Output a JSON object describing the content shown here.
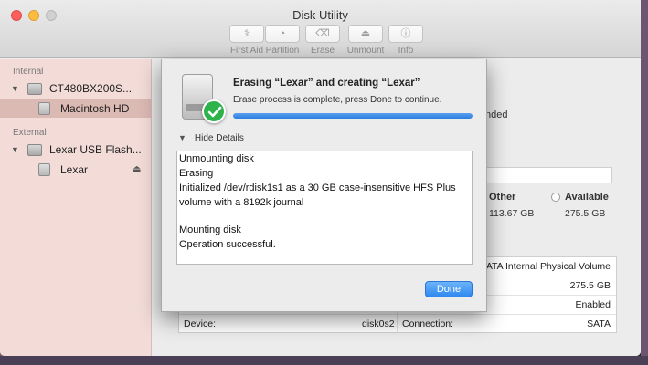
{
  "window": {
    "title": "Disk Utility"
  },
  "toolbar": {
    "buttons": [
      {
        "label": "First Aid",
        "icon": "stethoscope-icon",
        "glyph": "⚕"
      },
      {
        "label": "Partition",
        "icon": "partition-icon",
        "glyph": "◔"
      },
      {
        "label": "Erase",
        "icon": "erase-icon",
        "glyph": "⌫"
      },
      {
        "label": "Unmount",
        "icon": "unmount-icon",
        "glyph": "⏏"
      },
      {
        "label": "Info",
        "icon": "info-icon",
        "glyph": "ⓘ"
      }
    ]
  },
  "sidebar": {
    "internal_header": "Internal",
    "external_header": "External",
    "items": [
      {
        "label": "CT480BX200S...",
        "type": "disk"
      },
      {
        "label": "Macintosh HD",
        "type": "volume",
        "selected": true
      },
      {
        "label": "Lexar USB Flash...",
        "type": "disk"
      },
      {
        "label": "Lexar",
        "type": "volume"
      }
    ]
  },
  "background_panel": {
    "partial_status": "nded",
    "legend": [
      {
        "label": "Other",
        "value": "113.67 GB"
      },
      {
        "label": "Available",
        "value": "275.5 GB"
      }
    ],
    "info_rows": [
      {
        "right_value": "SATA Internal Physical Volume"
      },
      {
        "right_value": "275.5 GB"
      },
      {
        "right_value": "Enabled"
      },
      {
        "left_label": "Device:",
        "left_value": "disk0s2",
        "right_label": "Connection:",
        "right_value": "SATA"
      }
    ]
  },
  "sheet": {
    "title": "Erasing “Lexar” and creating “Lexar”",
    "subtitle": "Erase process is complete, press Done to continue.",
    "progress_percent": 100,
    "details_toggle": "Hide Details",
    "log_lines": [
      "Unmounting disk",
      "Erasing",
      "Initialized /dev/rdisk1s1 as a 30 GB case-insensitive HFS Plus",
      "volume with a 8192k journal",
      "",
      "Mounting disk",
      "Operation successful."
    ],
    "done_label": "Done"
  },
  "colors": {
    "accent": "#2f88f0",
    "success": "#2db34a",
    "sidebar_bg": "#f3dcd8",
    "sidebar_selected": "#dcbab4"
  }
}
